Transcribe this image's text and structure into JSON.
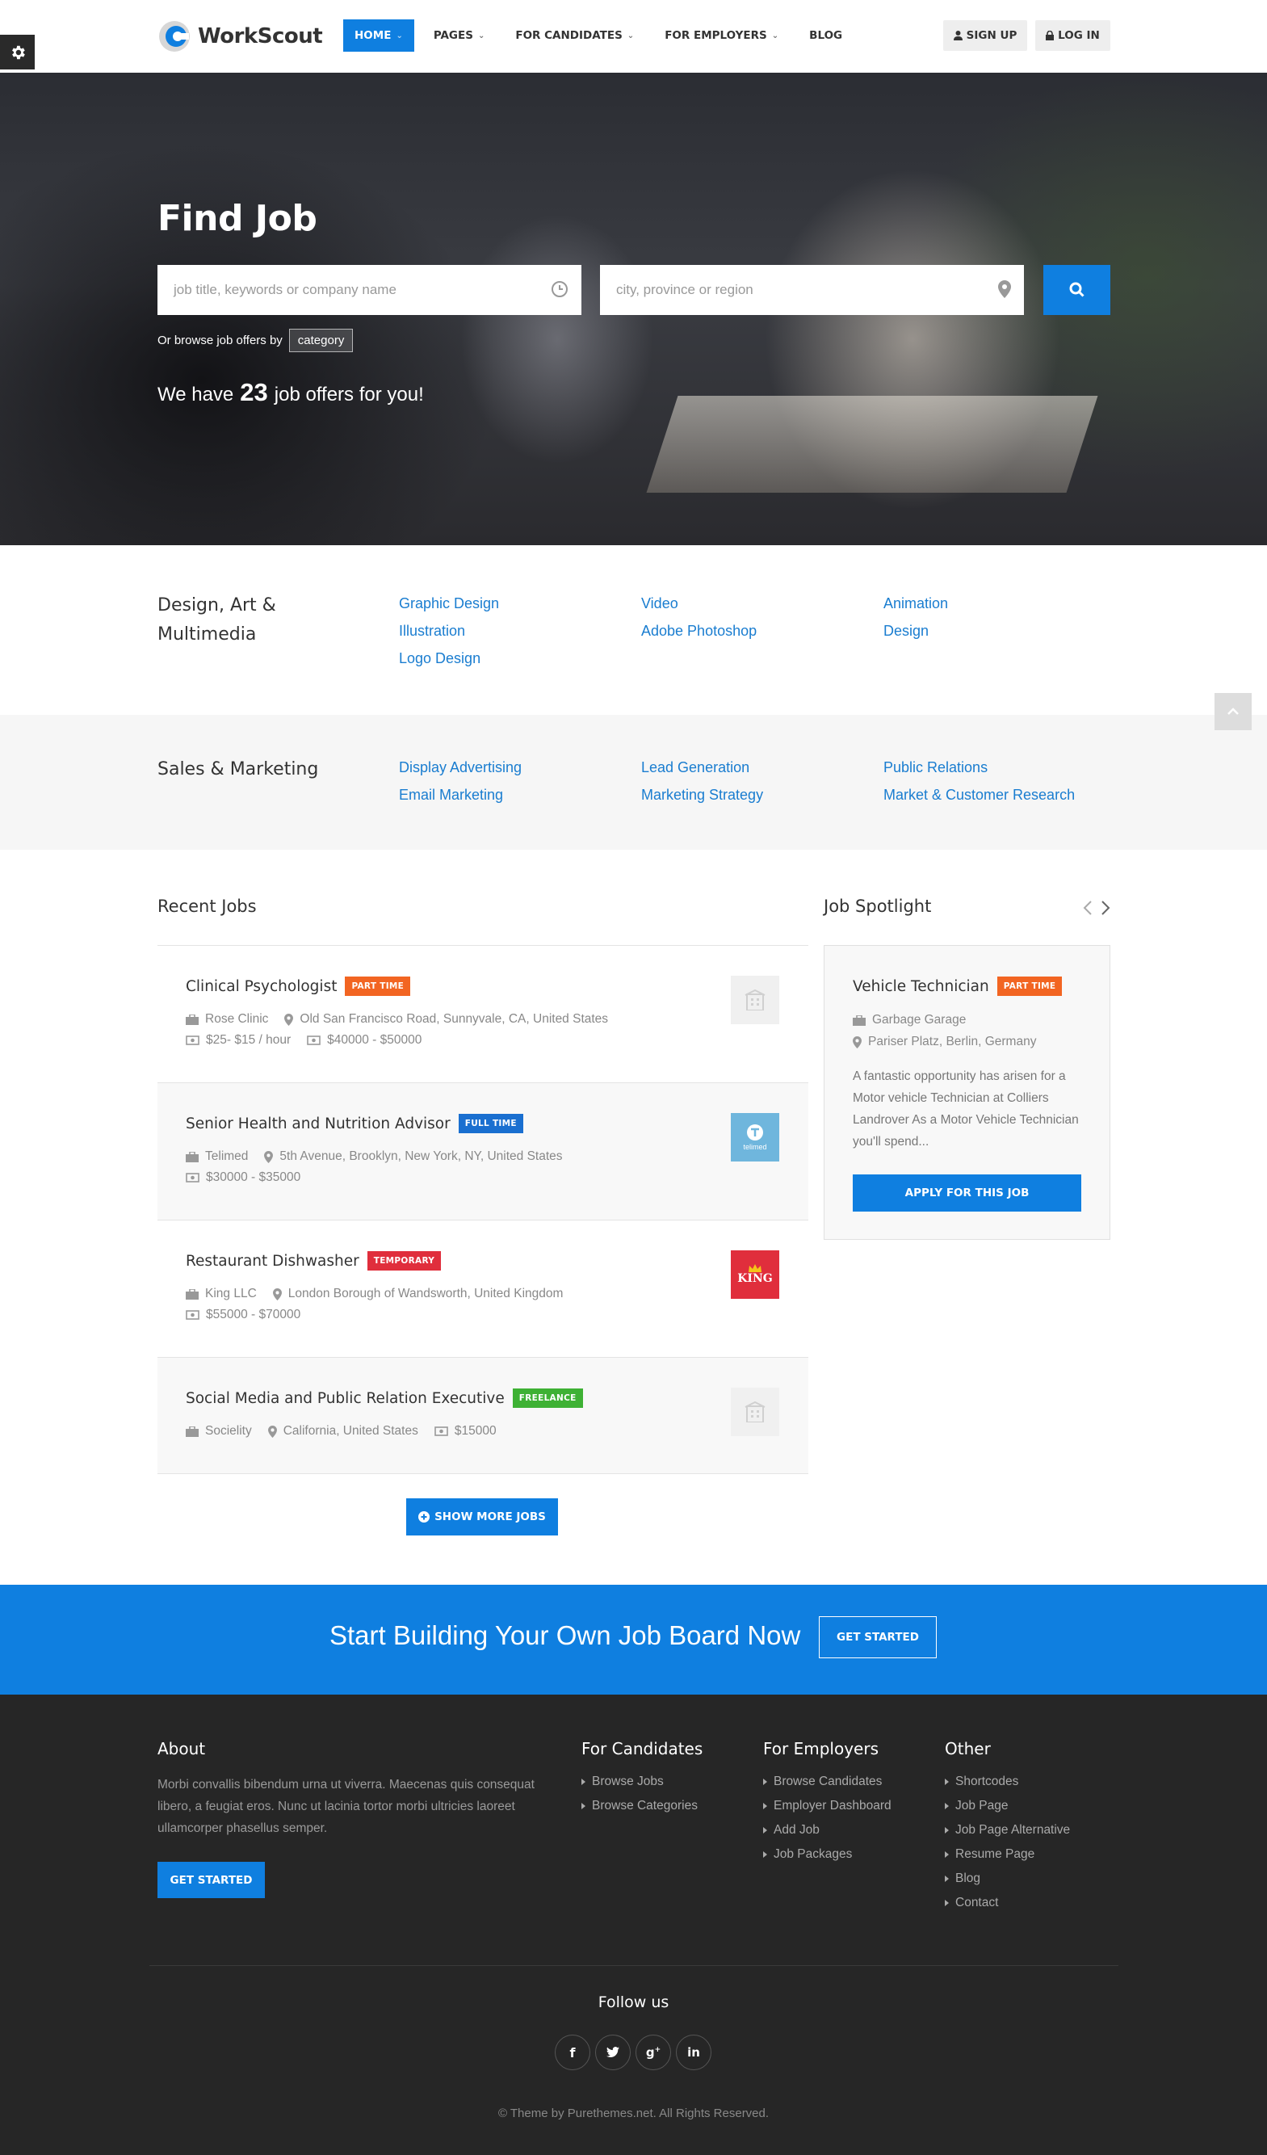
{
  "brand": {
    "name": "WorkScout",
    "accent": "#0f7fe0"
  },
  "nav": {
    "items": [
      {
        "label": "HOME",
        "active": true,
        "dropdown": true
      },
      {
        "label": "PAGES",
        "dropdown": true
      },
      {
        "label": "FOR CANDIDATES",
        "dropdown": true
      },
      {
        "label": "FOR EMPLOYERS",
        "dropdown": true
      },
      {
        "label": "BLOG",
        "dropdown": false
      }
    ],
    "sign_up": "SIGN UP",
    "log_in": "LOG IN"
  },
  "hero": {
    "title": "Find Job",
    "keywords_placeholder": "job title, keywords or company name",
    "location_placeholder": "city, province or region",
    "browse_prefix": "Or browse job offers by",
    "browse_tag": "category",
    "offers_prefix": "We have",
    "offers_count": "23",
    "offers_suffix": "job offers for you!"
  },
  "categories": [
    {
      "title": "Design, Art & Multimedia",
      "links": [
        "Graphic Design",
        "Video",
        "Animation",
        "Illustration",
        "Adobe Photoshop",
        "Design",
        "Logo Design"
      ]
    },
    {
      "title": "Sales & Marketing",
      "links": [
        "Display Advertising",
        "Lead Generation",
        "Public Relations",
        "Email Marketing",
        "Marketing Strategy",
        "Market & Customer Research"
      ]
    }
  ],
  "recent_jobs": {
    "title": "Recent Jobs",
    "jobs": [
      {
        "title": "Clinical Psychologist",
        "badge": "PART TIME",
        "badge_color": "#f26522",
        "company": "Rose Clinic",
        "location": "Old San Francisco Road, Sunnyvale, CA, United States",
        "rate": "$25- $15 / hour",
        "salary": "$40000 - $50000",
        "logo": "placeholder"
      },
      {
        "title": "Senior Health and Nutrition Advisor",
        "badge": "FULL TIME",
        "badge_color": "#1a6fd0",
        "company": "Telimed",
        "location": "5th Avenue, Brooklyn, New York, NY, United States",
        "salary": "$30000 - $35000",
        "logo": "telimed",
        "logo_text": "telimed"
      },
      {
        "title": "Restaurant Dishwasher",
        "badge": "TEMPORARY",
        "badge_color": "#e02e3c",
        "company": "King LLC",
        "location": "London Borough of Wandsworth, United Kingdom",
        "salary": "$55000 - $70000",
        "logo": "king",
        "logo_text": "KING"
      },
      {
        "title": "Social Media and Public Relation Executive",
        "badge": "FREELANCE",
        "badge_color": "#3eb134",
        "company": "Socielity",
        "location": "California, United States",
        "salary": "$15000",
        "logo": "placeholder"
      }
    ],
    "show_more": "SHOW MORE JOBS"
  },
  "spotlight": {
    "title": "Job Spotlight",
    "job_title": "Vehicle Technician",
    "badge": "PART TIME",
    "badge_color": "#f26522",
    "company": "Garbage Garage",
    "location": "Pariser Platz, Berlin, Germany",
    "description": "A fantastic opportunity has arisen for a Motor vehicle Technician at Colliers Landrover As a Motor Vehicle Technician you'll spend...",
    "apply": "APPLY FOR THIS JOB"
  },
  "cta": {
    "text": "Start Building Your Own Job Board Now",
    "button": "GET STARTED"
  },
  "footer": {
    "about_title": "About",
    "about_text": "Morbi convallis bibendum urna ut viverra. Maecenas quis consequat libero, a feugiat eros. Nunc ut lacinia tortor morbi ultricies laoreet ullamcorper phasellus semper.",
    "about_button": "GET STARTED",
    "columns": [
      {
        "title": "For Candidates",
        "links": [
          "Browse Jobs",
          "Browse Categories"
        ]
      },
      {
        "title": "For Employers",
        "links": [
          "Browse Candidates",
          "Employer Dashboard",
          "Add Job",
          "Job Packages"
        ]
      },
      {
        "title": "Other",
        "links": [
          "Shortcodes",
          "Job Page",
          "Job Page Alternative",
          "Resume Page",
          "Blog",
          "Contact"
        ]
      }
    ],
    "follow": "Follow us",
    "social": [
      "facebook",
      "twitter",
      "google-plus",
      "linkedin"
    ],
    "copyright": "© Theme by Purethemes.net. All Rights Reserved."
  }
}
